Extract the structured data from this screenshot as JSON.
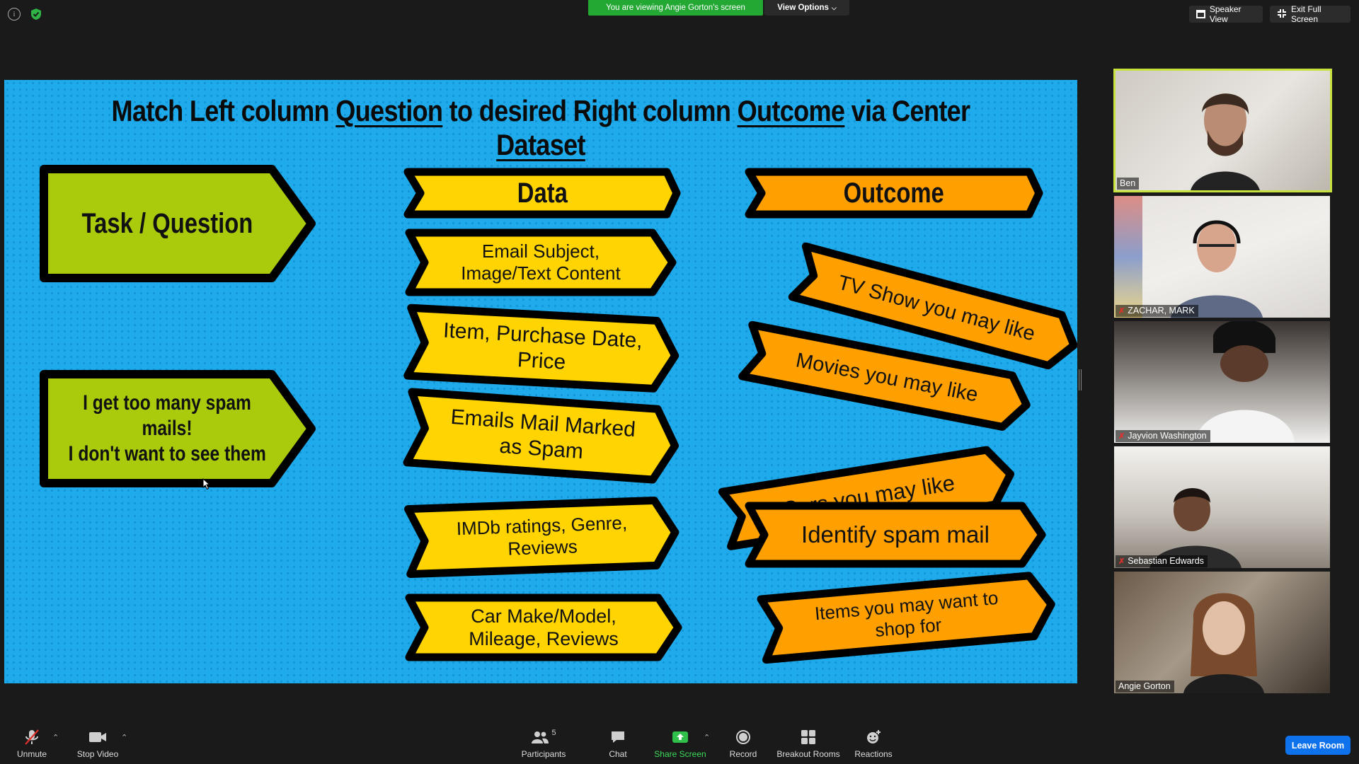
{
  "meeting": {
    "viewing_banner": "You are viewing Angie Gorton's screen",
    "view_options": "View Options",
    "speaker_view": "Speaker View",
    "exit_full_screen": "Exit Full Screen"
  },
  "slide": {
    "title_parts": [
      "Match Left column ",
      "Question",
      " to desired Right column ",
      "Outcome",
      " via Center ",
      "Dataset"
    ],
    "task_header": "Task / Question",
    "task_example_line1": "I get too many spam mails!",
    "task_example_line2": "I don't want to see them",
    "data_header": "Data",
    "data_items": [
      {
        "line1": "Email Subject,",
        "line2": "Image/Text Content"
      },
      {
        "line1": "Item, Purchase Date,",
        "line2": "Price"
      },
      {
        "line1": "Emails Mail Marked",
        "line2": "as Spam"
      },
      {
        "line1": "IMDb ratings, Genre,",
        "line2": "Reviews"
      },
      {
        "line1": "Car Make/Model,",
        "line2": "Mileage, Reviews"
      }
    ],
    "outcome_header": "Outcome",
    "outcome_items": [
      {
        "line1": "TV Show you may like",
        "line2": ""
      },
      {
        "line1": "Movies you may like",
        "line2": ""
      },
      {
        "line1": "Cars you may like",
        "line2": ""
      },
      {
        "line1": "Identify spam mail",
        "line2": ""
      },
      {
        "line1": "Items you may want to",
        "line2": "shop for"
      }
    ],
    "colors": {
      "background": "#1faaeb",
      "task": "#a9cb0b",
      "data": "#ffd400",
      "outcome": "#ffa000"
    }
  },
  "participants": [
    {
      "name": "Ben",
      "muted": false
    },
    {
      "name": "ZACHAR, MARK",
      "muted": true
    },
    {
      "name": "Jayvion Washington",
      "muted": true
    },
    {
      "name": "Sebastian Edwards",
      "muted": true
    },
    {
      "name": "Angie Gorton",
      "muted": false
    }
  ],
  "toolbar": {
    "unmute": "Unmute",
    "stop_video": "Stop Video",
    "participants": "Participants",
    "participants_count": "5",
    "chat": "Chat",
    "share_screen": "Share Screen",
    "record": "Record",
    "breakout_rooms": "Breakout Rooms",
    "reactions": "Reactions",
    "leave_room": "Leave Room"
  }
}
